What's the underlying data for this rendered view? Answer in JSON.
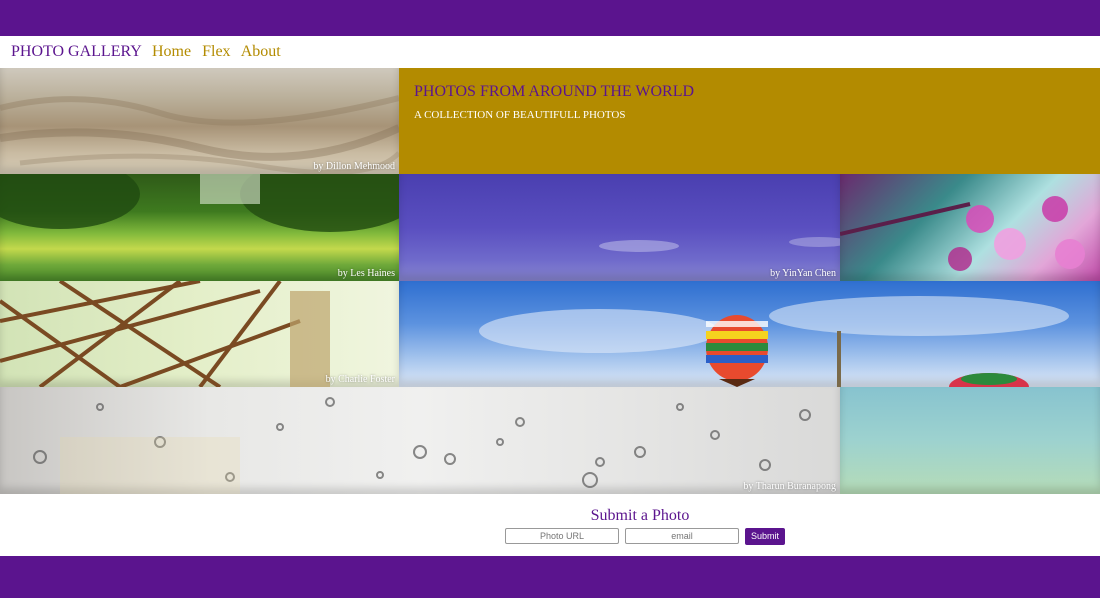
{
  "nav": {
    "brand": "PHOTO GALLERY",
    "links": [
      "Home",
      "Flex",
      "About"
    ]
  },
  "hero": {
    "title": "PHOTOS FROM AROUND THE WORLD",
    "subtitle": "A COLLECTION OF BEAUTIFULL PHOTOS"
  },
  "photos": [
    {
      "credit": "by Dillon Mehmood"
    },
    {
      "credit": "by Les Haines"
    },
    {
      "credit": "by YinYan Chen"
    },
    {
      "credit": ""
    },
    {
      "credit": "by Charlie Foster"
    },
    {
      "credit": ""
    },
    {
      "credit": "by Tharun Buranapong"
    },
    {
      "credit": ""
    }
  ],
  "submit": {
    "heading": "Submit a Photo",
    "url_placeholder": "Photo URL",
    "email_placeholder": "email",
    "button_label": "Submit"
  },
  "colors": {
    "brand_purple": "#5b148e",
    "gold": "#b38b00"
  }
}
